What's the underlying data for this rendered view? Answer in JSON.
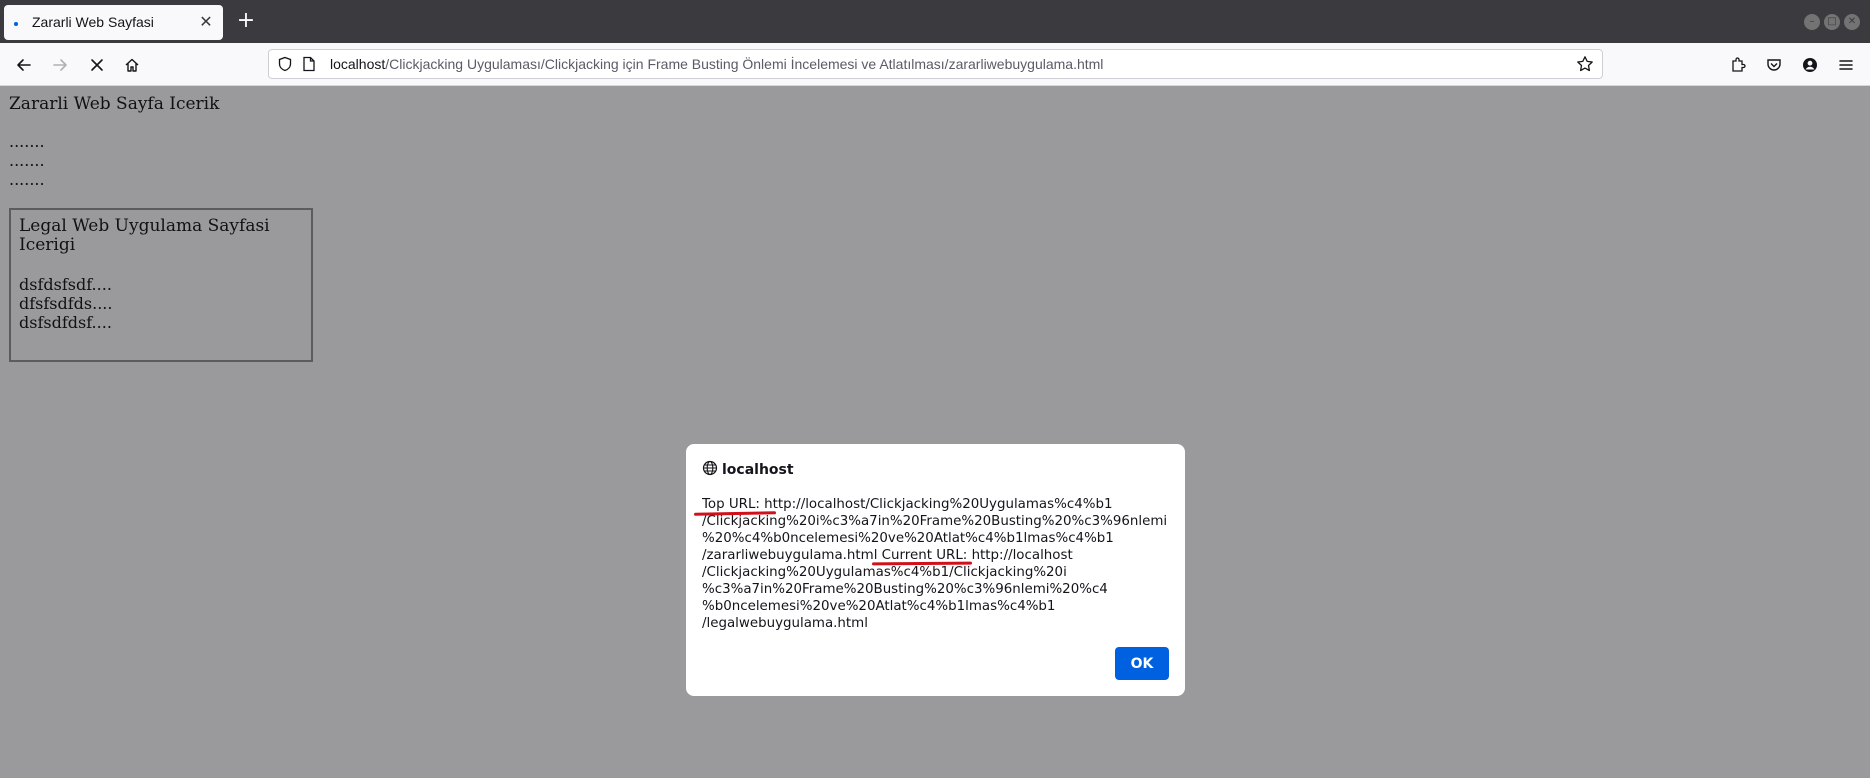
{
  "browser": {
    "tab": {
      "title": "Zararli Web Sayfasi"
    },
    "url": {
      "host": "localhost",
      "path": "/Clickjacking Uygulaması/Clickjacking için Frame Busting Önlemi İncelemesi ve Atlatılması/zararliwebuygulama.html"
    },
    "icons": {
      "back": "arrow-left-icon",
      "forward": "arrow-right-icon",
      "stop": "close-icon",
      "home": "home-icon",
      "bookmark": "star-icon"
    }
  },
  "page": {
    "heading": "Zararli Web Sayfa Icerik",
    "dots": [
      ".......",
      ".......",
      "......."
    ],
    "frame": {
      "heading": "Legal Web Uygulama Sayfasi Icerigi",
      "lines": [
        "dsfdsfsdf....",
        "dfsfsdfds....",
        "dsfsdfdsf...."
      ]
    }
  },
  "dialog": {
    "host": "localhost",
    "message": "Top URL: http://localhost/Clickjacking%20Uygulamas%c4%b1\n/Clickjacking%20i%c3%a7in%20Frame%20Busting%20%c3%96nlemi\n%20%c4%b0ncelemesi%20ve%20Atlat%c4%b1lmas%c4%b1\n/zararliwebuygulama.html Current URL: http://localhost\n/Clickjacking%20Uygulamas%c4%b1/Clickjacking%20i\n%c3%a7in%20Frame%20Busting%20%c3%96nlemi%20%c4\n%b0ncelemesi%20ve%20Atlat%c4%b1lmas%c4%b1\n/legalwebuygulama.html",
    "ok_label": "OK"
  },
  "colors": {
    "accent": "#0061e0",
    "annotation": "#d0101a"
  }
}
